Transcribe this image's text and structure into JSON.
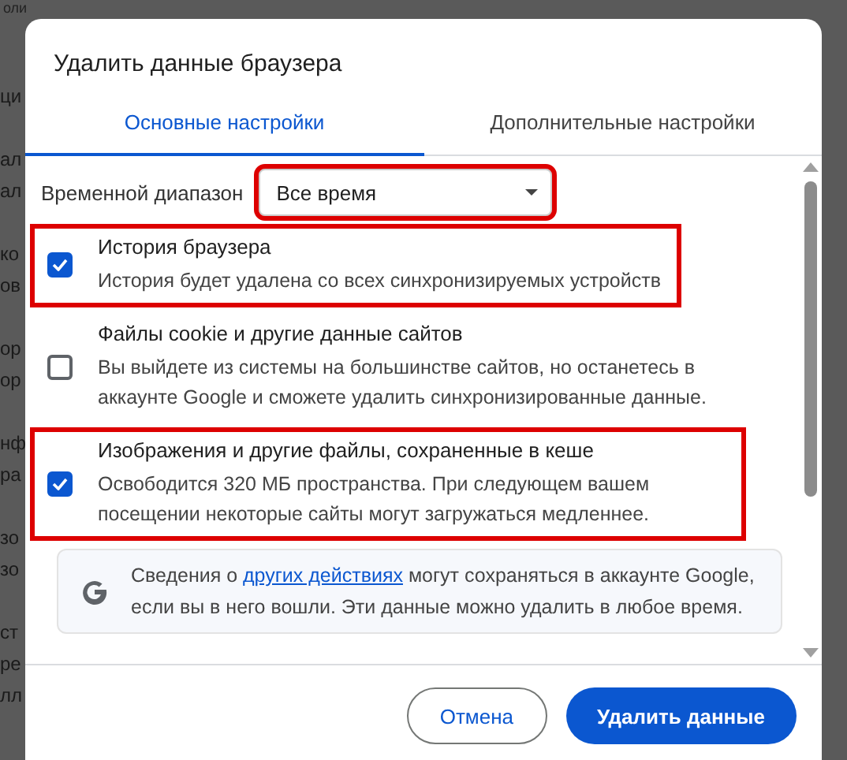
{
  "background": {
    "top_fragment": "оли",
    "fragments": [
      [
        "ци"
      ],
      [
        "ал",
        "ал"
      ],
      [
        "ко",
        "ов"
      ],
      [
        "ор",
        "ор"
      ],
      [
        "нф",
        "ра"
      ],
      [
        "зо",
        "зо"
      ],
      [
        "ст",
        "ре",
        "лл"
      ]
    ]
  },
  "dialog": {
    "title": "Удалить данные браузера",
    "tabs": [
      {
        "label": "Основные настройки",
        "selected": true
      },
      {
        "label": "Дополнительные настройки",
        "selected": false
      }
    ],
    "time_range": {
      "label": "Временной диапазон",
      "value": "Все время",
      "highlighted": true
    },
    "items": [
      {
        "title": "История браузера",
        "description": "История будет удалена со всех синхронизируемых устройств",
        "checked": true,
        "highlighted": true
      },
      {
        "title": "Файлы cookie и другие данные сайтов",
        "description": "Вы выйдете из системы на большинстве сайтов, но останетесь в аккаунте Google и сможете удалить синхронизированные данные.",
        "checked": false,
        "highlighted": false
      },
      {
        "title": "Изображения и другие файлы, сохраненные в кеше",
        "description": "Освободится 320 МБ пространства. При следующем вашем посещении некоторые сайты могут загружаться медленнее.",
        "checked": true,
        "highlighted": true
      }
    ],
    "info": {
      "before": "Сведения о ",
      "link": "других действиях",
      "after": " могут сохраняться в аккаунте Google, если вы в него вошли. Эти данные можно удалить в любое время."
    },
    "buttons": {
      "cancel": "Отмена",
      "confirm": "Удалить данные"
    }
  }
}
